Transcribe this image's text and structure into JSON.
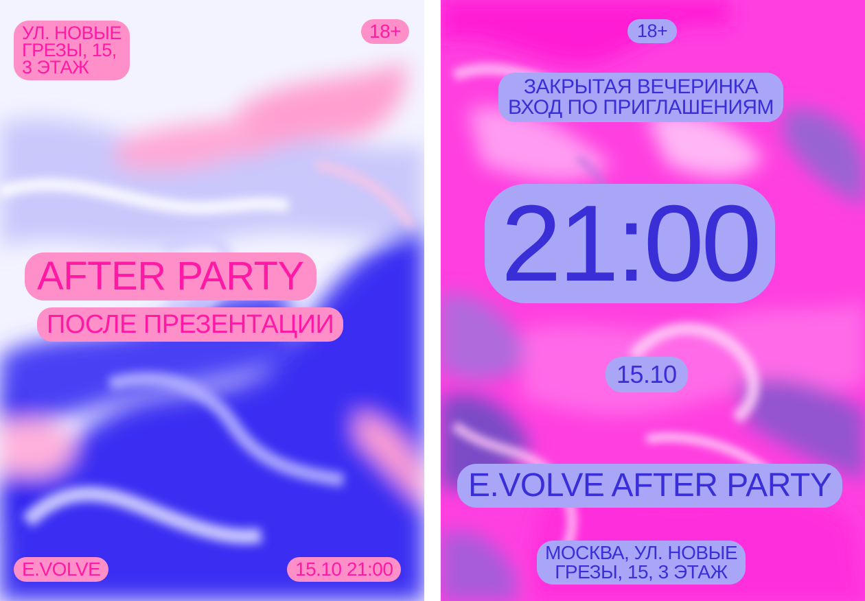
{
  "left_poster": {
    "address_lines": [
      "УЛ. НОВЫЕ",
      "ГРЕЗЫ, 15,",
      "3 ЭТАЖ"
    ],
    "age_badge": "18+",
    "title": "AFTER PARTY",
    "subtitle": "ПОСЛЕ ПРЕЗЕНТАЦИИ",
    "brand": "E.VOLVE",
    "datetime": "15.10 21:00",
    "colors": {
      "text": "#ff1aa6",
      "sticker": "#ff8fc8",
      "blue": "#2f23f0",
      "white": "#f4f4ff"
    }
  },
  "right_poster": {
    "age_badge": "18+",
    "invite_lines": [
      "ЗАКРЫТАЯ ВЕЧЕРИНКА",
      "ВХОД ПО ПРИГЛАШЕНИЯМ"
    ],
    "time": "21:00",
    "date": "15.10",
    "event_name": "E.VOLVE AFTER PARTY",
    "address_lines": [
      "МОСКВА, УЛ. НОВЫЕ",
      "ГРЕЗЫ, 15, 3 ЭТАЖ"
    ],
    "colors": {
      "text": "#3a2fd6",
      "sticker": "#a9a6f8",
      "magenta": "#ff33dd",
      "violet": "#7b52c8"
    }
  }
}
